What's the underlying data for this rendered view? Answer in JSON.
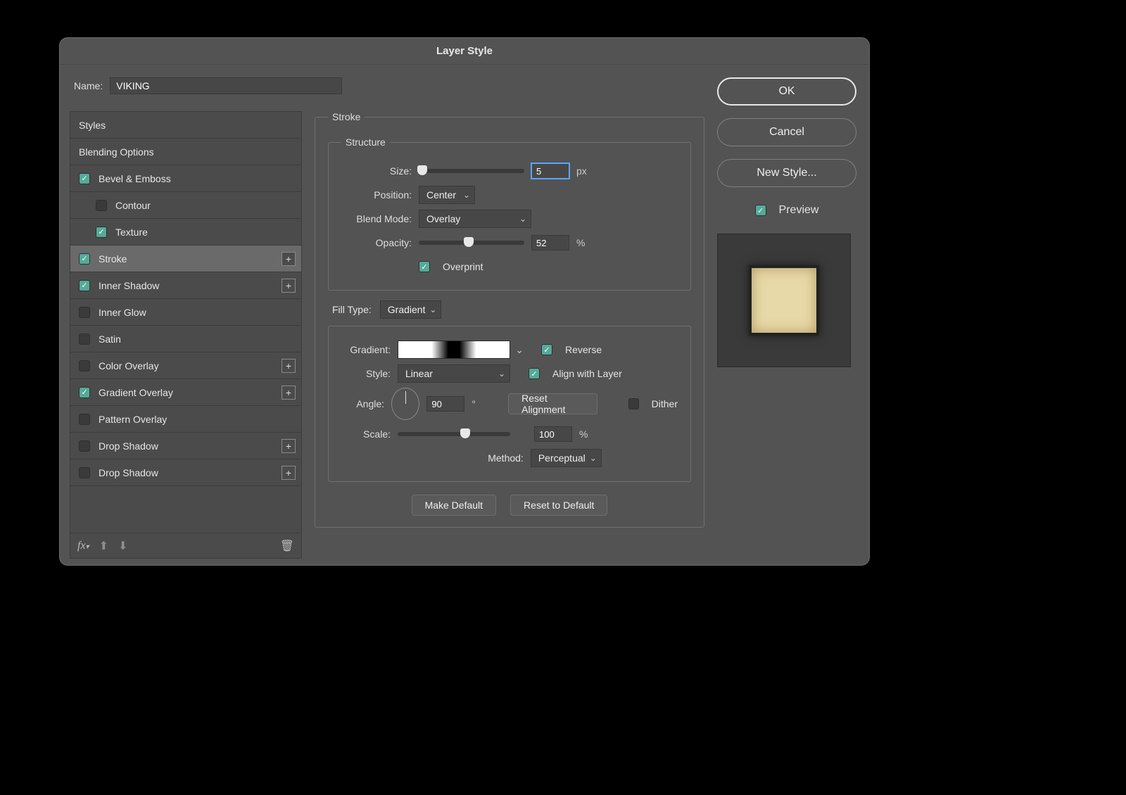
{
  "dialog": {
    "title": "Layer Style"
  },
  "name": {
    "label": "Name:",
    "value": "VIKING"
  },
  "sidebar": {
    "header_styles": "Styles",
    "header_blending": "Blending Options",
    "items": [
      {
        "label": "Bevel & Emboss",
        "checked": true,
        "plus": false,
        "sub": false
      },
      {
        "label": "Contour",
        "checked": false,
        "plus": false,
        "sub": true
      },
      {
        "label": "Texture",
        "checked": true,
        "plus": false,
        "sub": true
      },
      {
        "label": "Stroke",
        "checked": true,
        "plus": true,
        "sub": false,
        "selected": true
      },
      {
        "label": "Inner Shadow",
        "checked": true,
        "plus": true,
        "sub": false
      },
      {
        "label": "Inner Glow",
        "checked": false,
        "plus": false,
        "sub": false
      },
      {
        "label": "Satin",
        "checked": false,
        "plus": false,
        "sub": false
      },
      {
        "label": "Color Overlay",
        "checked": false,
        "plus": true,
        "sub": false
      },
      {
        "label": "Gradient Overlay",
        "checked": true,
        "plus": true,
        "sub": false
      },
      {
        "label": "Pattern Overlay",
        "checked": false,
        "plus": false,
        "sub": false
      },
      {
        "label": "Drop Shadow",
        "checked": false,
        "plus": true,
        "sub": false
      },
      {
        "label": "Drop Shadow",
        "checked": false,
        "plus": true,
        "sub": false
      }
    ]
  },
  "main": {
    "section_title": "Stroke",
    "structure": {
      "legend": "Structure",
      "size_label": "Size:",
      "size_value": "5",
      "size_unit": "px",
      "size_pct": 3,
      "position_label": "Position:",
      "position_value": "Center",
      "blend_label": "Blend Mode:",
      "blend_value": "Overlay",
      "opacity_label": "Opacity:",
      "opacity_value": "52",
      "opacity_unit": "%",
      "opacity_pct": 47,
      "overprint_label": "Overprint",
      "overprint_checked": true
    },
    "fill": {
      "filltype_label": "Fill Type:",
      "filltype_value": "Gradient",
      "gradient_label": "Gradient:",
      "reverse_label": "Reverse",
      "reverse_checked": true,
      "style_label": "Style:",
      "style_value": "Linear",
      "align_label": "Align with Layer",
      "align_checked": true,
      "angle_label": "Angle:",
      "angle_value": "90",
      "angle_unit": "°",
      "reset_align_label": "Reset Alignment",
      "dither_label": "Dither",
      "dither_checked": false,
      "scale_label": "Scale:",
      "scale_value": "100",
      "scale_unit": "%",
      "scale_pct": 60,
      "method_label": "Method:",
      "method_value": "Perceptual"
    },
    "make_default": "Make Default",
    "reset_default": "Reset to Default"
  },
  "right": {
    "ok": "OK",
    "cancel": "Cancel",
    "new_style": "New Style...",
    "preview_label": "Preview",
    "preview_checked": true
  }
}
